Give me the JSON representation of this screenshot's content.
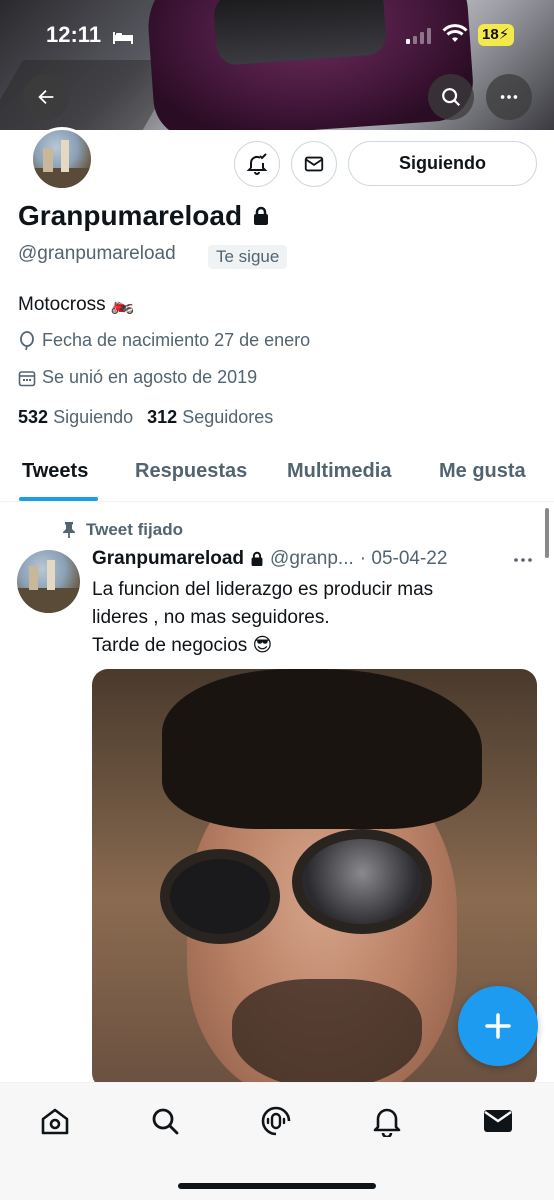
{
  "status_bar": {
    "time": "12:11",
    "battery": "18"
  },
  "profile": {
    "name": "Granpumareload",
    "handle": "@granpumareload",
    "follows_you_badge": "Te sigue",
    "follow_button": "Siguiendo",
    "bio": "Motocross 🏍️",
    "birth_date": "Fecha de nacimiento 27 de enero",
    "joined": "Se unió en agosto de 2019",
    "following_count": "532",
    "following_label": "Siguiendo",
    "followers_count": "312",
    "followers_label": "Seguidores"
  },
  "tabs": [
    "Tweets",
    "Respuestas",
    "Multimedia",
    "Me gusta"
  ],
  "pinned_tweet": {
    "pinned_label": "Tweet fijado",
    "author": "Granpumareload",
    "handle": "@granp...",
    "date": "· 05-04-22",
    "lines": [
      "La funcion del liderazgo es producir mas",
      "lideres , no mas seguidores.",
      "Tarde de negocios 😎"
    ]
  },
  "colors": {
    "accent": "#1d9bf0",
    "text": "#0f1419",
    "muted": "#536471",
    "border": "#cfd9de"
  },
  "icons": {
    "nav": [
      "home-icon",
      "search-icon",
      "spaces-icon",
      "notifications-icon",
      "messages-icon"
    ],
    "header": [
      "back-arrow-icon",
      "search-icon",
      "more-icon"
    ]
  }
}
